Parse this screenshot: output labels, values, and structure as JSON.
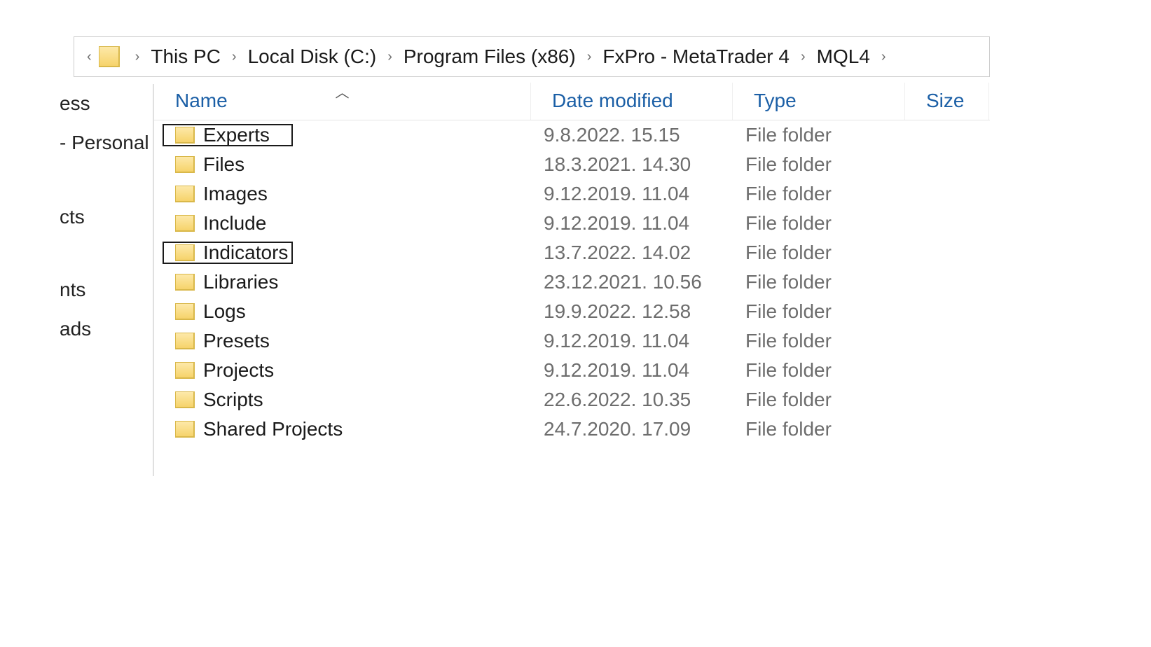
{
  "breadcrumb": {
    "items": [
      "This PC",
      "Local Disk (C:)",
      "Program Files (x86)",
      "FxPro - MetaTrader 4",
      "MQL4"
    ]
  },
  "nav": {
    "items": [
      "ess",
      "  - Personal",
      "cts",
      "nts",
      "ads"
    ]
  },
  "columns": {
    "name": "Name",
    "date": "Date modified",
    "type": "Type",
    "size": "Size"
  },
  "rows": [
    {
      "name": "Experts",
      "date": "9.8.2022. 15.15",
      "type": "File folder",
      "boxed": true
    },
    {
      "name": "Files",
      "date": "18.3.2021. 14.30",
      "type": "File folder",
      "boxed": false
    },
    {
      "name": "Images",
      "date": "9.12.2019. 11.04",
      "type": "File folder",
      "boxed": false
    },
    {
      "name": "Include",
      "date": "9.12.2019. 11.04",
      "type": "File folder",
      "boxed": false
    },
    {
      "name": "Indicators",
      "date": "13.7.2022. 14.02",
      "type": "File folder",
      "boxed": true
    },
    {
      "name": "Libraries",
      "date": "23.12.2021. 10.56",
      "type": "File folder",
      "boxed": false
    },
    {
      "name": "Logs",
      "date": "19.9.2022. 12.58",
      "type": "File folder",
      "boxed": false
    },
    {
      "name": "Presets",
      "date": "9.12.2019. 11.04",
      "type": "File folder",
      "boxed": false
    },
    {
      "name": "Projects",
      "date": "9.12.2019. 11.04",
      "type": "File folder",
      "boxed": false
    },
    {
      "name": "Scripts",
      "date": "22.6.2022. 10.35",
      "type": "File folder",
      "boxed": false
    },
    {
      "name": "Shared Projects",
      "date": "24.7.2020. 17.09",
      "type": "File folder",
      "boxed": false
    }
  ]
}
